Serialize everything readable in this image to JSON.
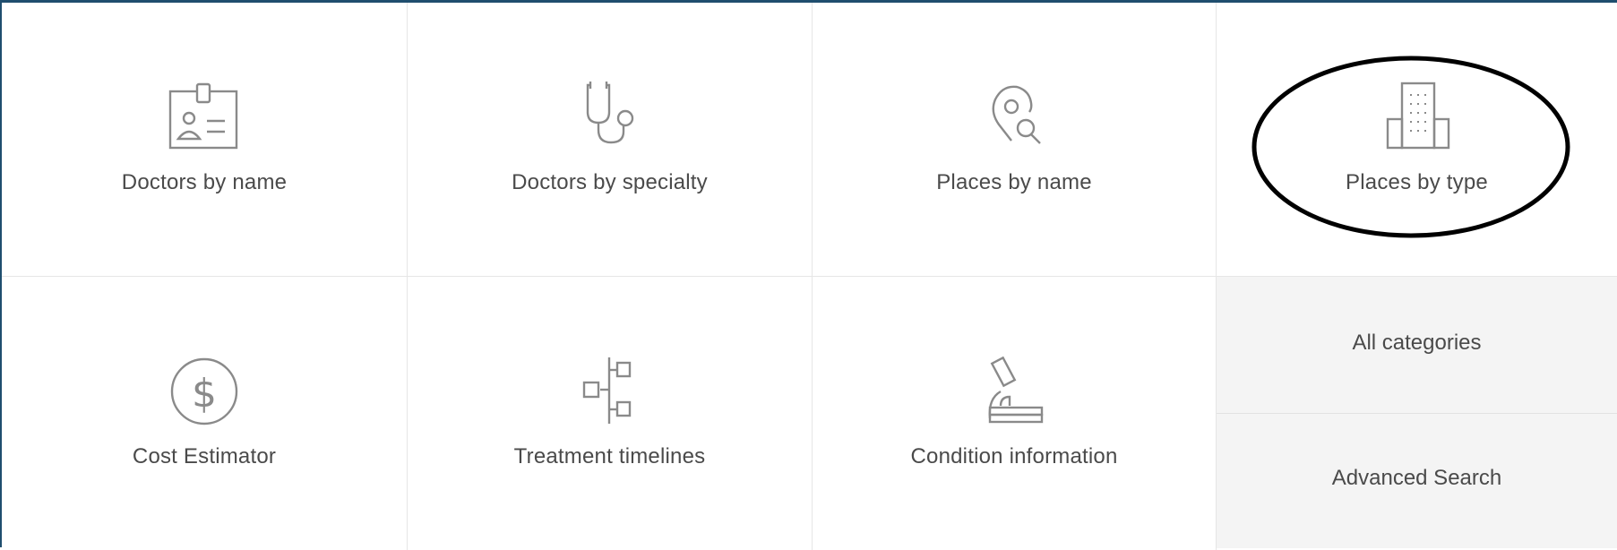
{
  "tiles": [
    {
      "label": "Doctors by name",
      "icon": "id-badge-icon"
    },
    {
      "label": "Doctors by specialty",
      "icon": "stethoscope-icon"
    },
    {
      "label": "Places by name",
      "icon": "location-search-icon"
    },
    {
      "label": "Places by type",
      "icon": "building-icon"
    },
    {
      "label": "Cost Estimator",
      "icon": "dollar-circle-icon"
    },
    {
      "label": "Treatment timelines",
      "icon": "flowchart-icon"
    },
    {
      "label": "Condition information",
      "icon": "microscope-icon"
    }
  ],
  "side_links": {
    "all_categories": "All categories",
    "advanced_search": "Advanced Search"
  },
  "colors": {
    "frame_border": "#1f4e6e",
    "icon_stroke": "#8a8a8a",
    "text": "#4a4a4a",
    "side_bg": "#f4f4f4",
    "annotation": "#000000"
  },
  "annotation": {
    "shape": "ellipse",
    "target": "Places by type"
  }
}
